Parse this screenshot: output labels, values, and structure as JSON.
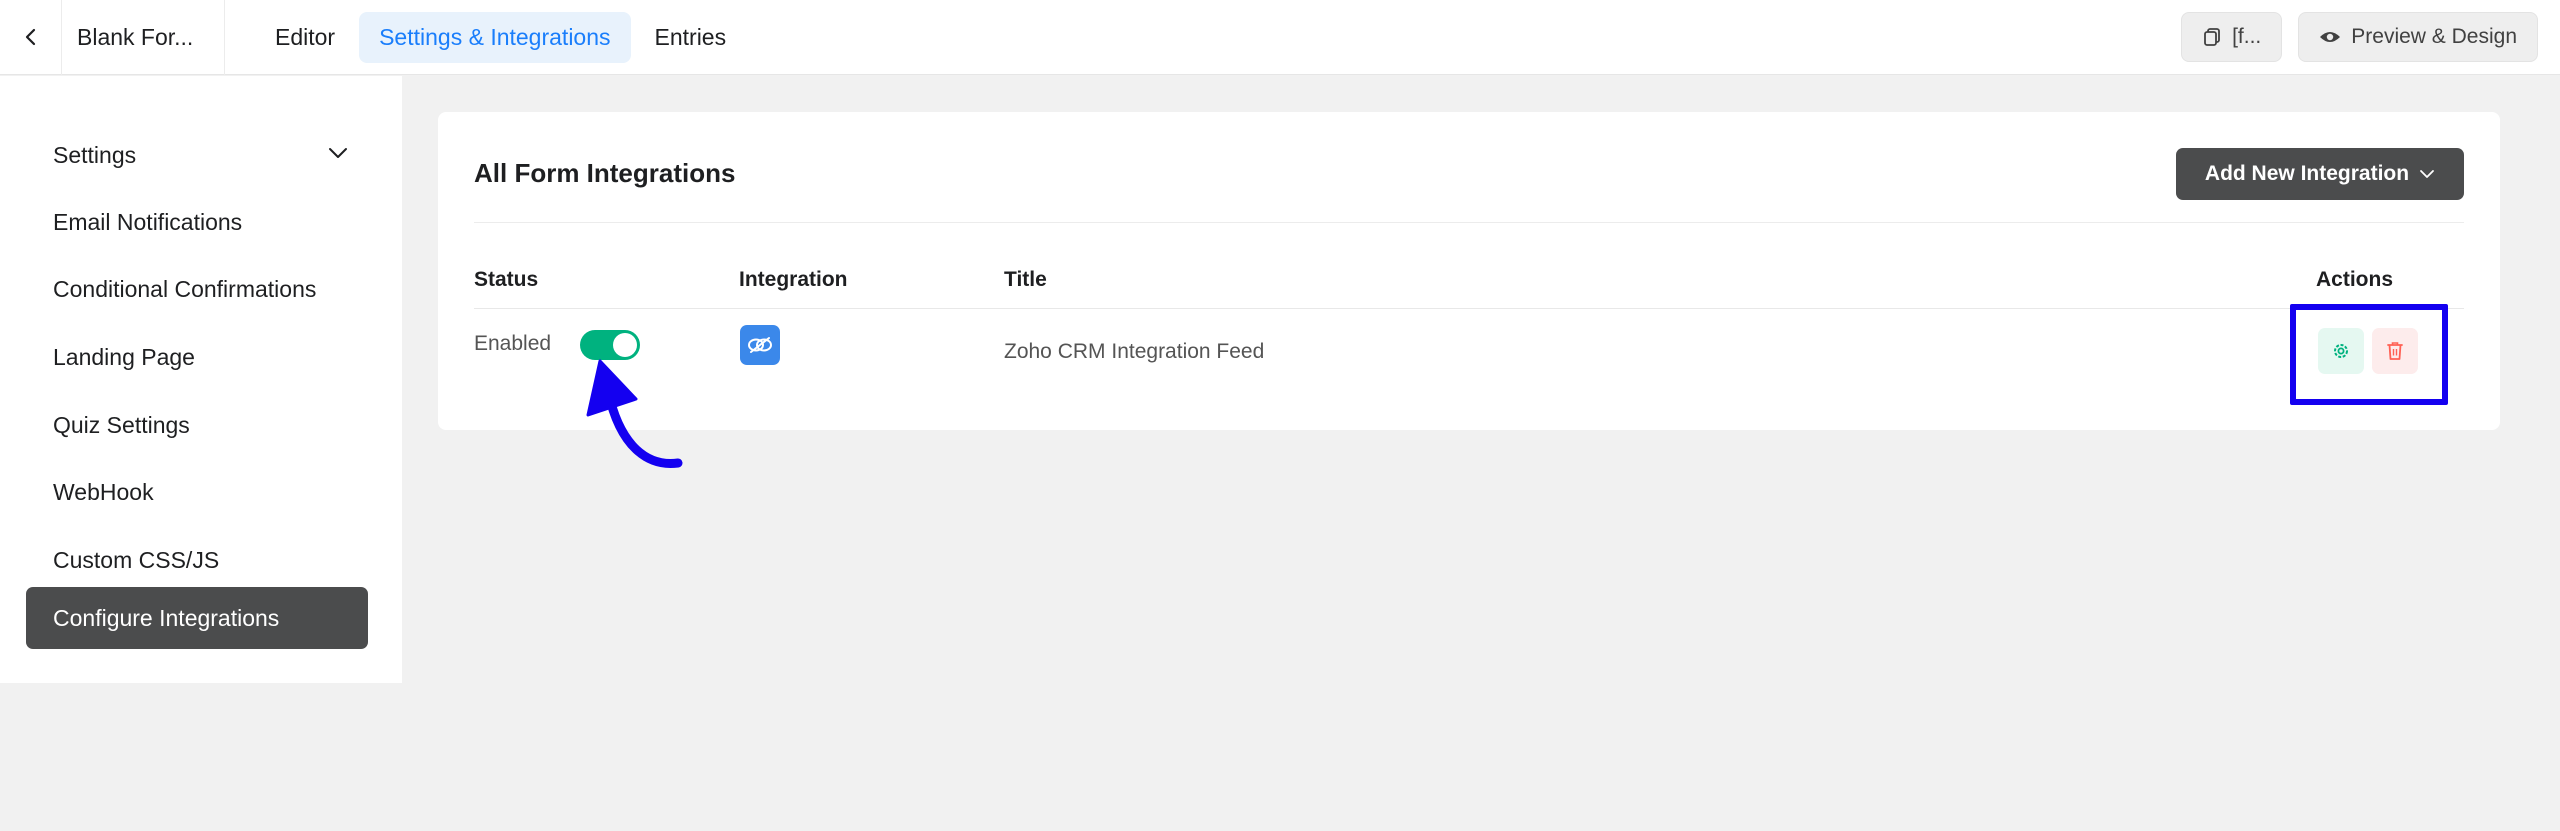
{
  "header": {
    "form_name": "Blank For...",
    "tabs": [
      {
        "label": "Editor",
        "active": false
      },
      {
        "label": "Settings & Integrations",
        "active": true
      },
      {
        "label": "Entries",
        "active": false
      }
    ],
    "shortcode_label": "[f...",
    "preview_label": "Preview & Design"
  },
  "sidebar": {
    "items": [
      {
        "label": "Settings",
        "active": false,
        "has_chevron": true
      },
      {
        "label": "Email Notifications",
        "active": false
      },
      {
        "label": "Conditional Confirmations",
        "active": false
      },
      {
        "label": "Landing Page",
        "active": false
      },
      {
        "label": "Quiz Settings",
        "active": false
      },
      {
        "label": "WebHook",
        "active": false
      },
      {
        "label": "Custom CSS/JS",
        "active": false
      },
      {
        "label": "Configure Integrations",
        "active": true
      }
    ]
  },
  "main": {
    "title": "All Form Integrations",
    "add_button_label": "Add New Integration",
    "columns": {
      "status": "Status",
      "integration": "Integration",
      "title": "Title",
      "actions": "Actions"
    },
    "rows": [
      {
        "status_text": "Enabled",
        "enabled": true,
        "integration_icon": "link-icon",
        "title": "Zoho CRM Integration Feed"
      }
    ]
  },
  "colors": {
    "accent_blue": "#1a7efb",
    "active_sidebar": "#4b4c4d",
    "toggle_on": "#00b27f",
    "annotation": "#1400f0"
  }
}
